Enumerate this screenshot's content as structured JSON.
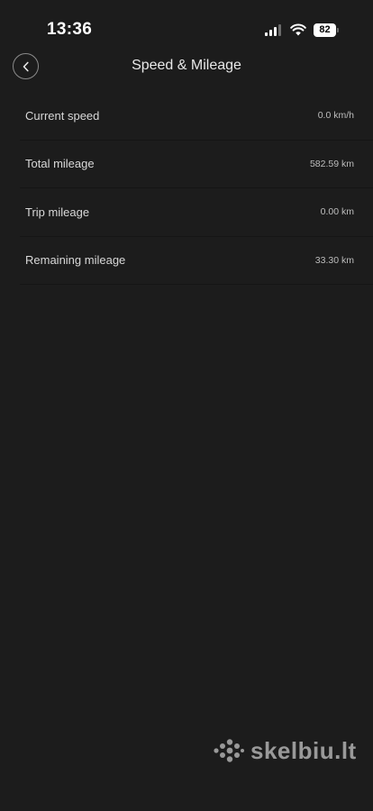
{
  "status_bar": {
    "time": "13:36",
    "battery_level": "82"
  },
  "header": {
    "title": "Speed & Mileage",
    "back_icon": "chevron-left-icon"
  },
  "items": [
    {
      "label": "Current speed",
      "value": "0.0 km/h"
    },
    {
      "label": "Total mileage",
      "value": "582.59 km"
    },
    {
      "label": "Trip mileage",
      "value": "0.00 km"
    },
    {
      "label": "Remaining mileage",
      "value": "33.30 km"
    }
  ],
  "watermark": {
    "text": "skelbiu.lt"
  },
  "colors": {
    "background": "#1c1c1c",
    "text": "#e6e6e6",
    "divider": "#151515"
  }
}
